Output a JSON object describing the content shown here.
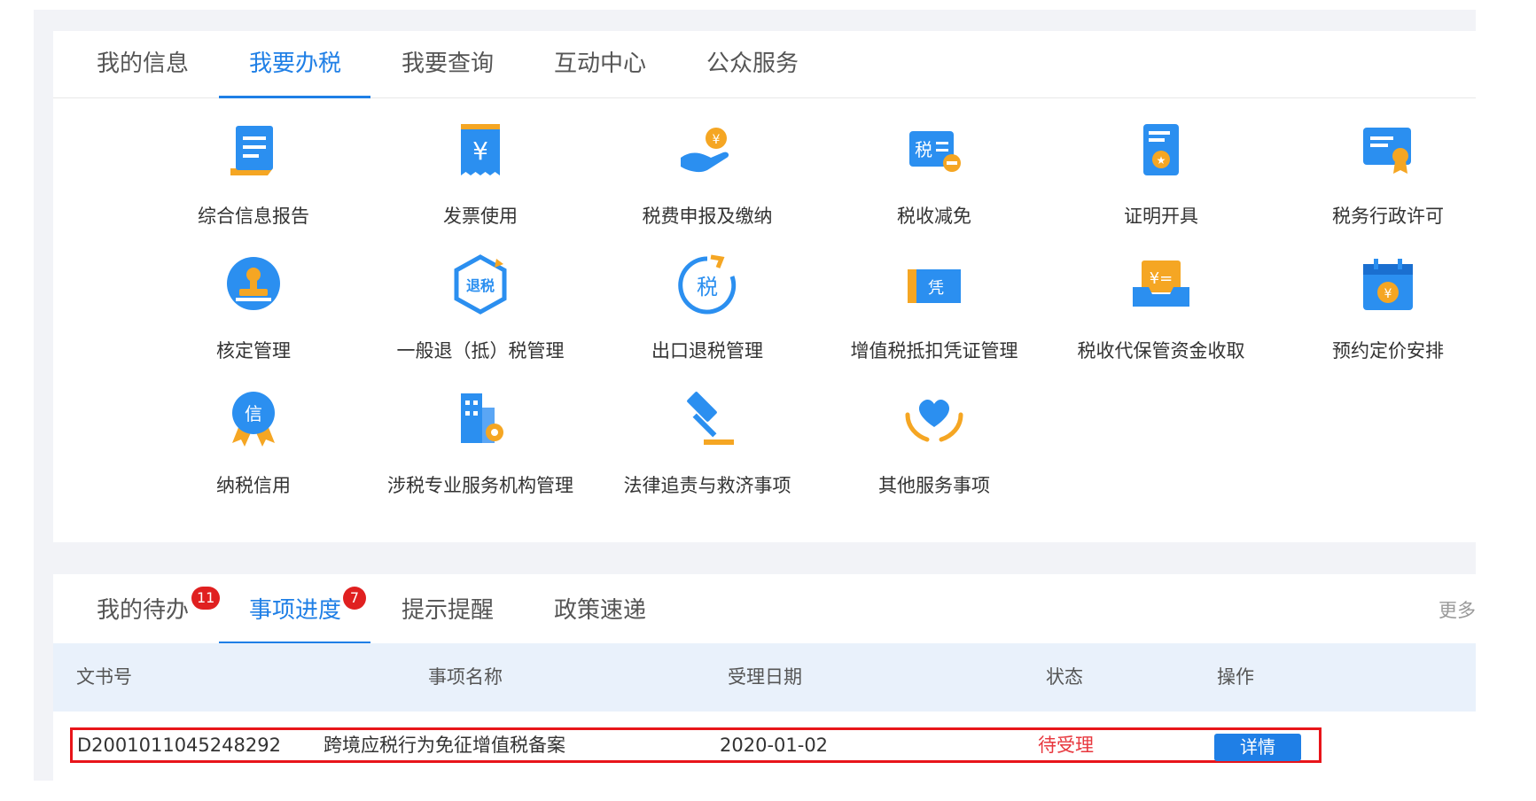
{
  "top_tabs": [
    "我的信息",
    "我要办税",
    "我要查询",
    "互动中心",
    "公众服务"
  ],
  "services": [
    {
      "label": "综合信息报告",
      "icon": "report-document-icon"
    },
    {
      "label": "发票使用",
      "icon": "invoice-yen-icon"
    },
    {
      "label": "税费申报及缴纳",
      "icon": "hand-coin-icon"
    },
    {
      "label": "税收减免",
      "icon": "tax-reduction-icon"
    },
    {
      "label": "证明开具",
      "icon": "certificate-icon"
    },
    {
      "label": "税务行政许可",
      "icon": "license-badge-icon"
    },
    {
      "label": "核定管理",
      "icon": "stamp-icon"
    },
    {
      "label": "一般退（抵）税管理",
      "icon": "tax-refund-hexagon-icon"
    },
    {
      "label": "出口退税管理",
      "icon": "export-refund-circle-icon"
    },
    {
      "label": "增值税抵扣凭证管理",
      "icon": "voucher-icon"
    },
    {
      "label": "税收代保管资金收取",
      "icon": "fund-tray-icon"
    },
    {
      "label": "预约定价安排",
      "icon": "calendar-yen-icon"
    },
    {
      "label": "纳税信用",
      "icon": "credit-medal-icon"
    },
    {
      "label": "涉税专业服务机构管理",
      "icon": "building-gear-icon"
    },
    {
      "label": "法律追责与救济事项",
      "icon": "gavel-icon"
    },
    {
      "label": "其他服务事项",
      "icon": "heart-hands-icon"
    }
  ],
  "bottom_tabs": [
    {
      "label": "我的待办",
      "badge": "11"
    },
    {
      "label": "事项进度",
      "badge": "7"
    },
    {
      "label": "提示提醒",
      "badge": ""
    },
    {
      "label": "政策速递",
      "badge": ""
    }
  ],
  "more_label": "更多",
  "table": {
    "headers": [
      "文书号",
      "事项名称",
      "受理日期",
      "状态",
      "操作"
    ],
    "rows": [
      {
        "doc_no": "D2001011045248292",
        "name": "跨境应税行为免征增值税备案",
        "date": "2020-01-02",
        "status": "待受理",
        "action": "详情"
      }
    ]
  },
  "colors": {
    "accent": "#1f7fe6",
    "badge": "#e02020",
    "status_pending": "#e8373d",
    "highlight_border": "#e8151a",
    "icon_orange": "#f5a623"
  }
}
